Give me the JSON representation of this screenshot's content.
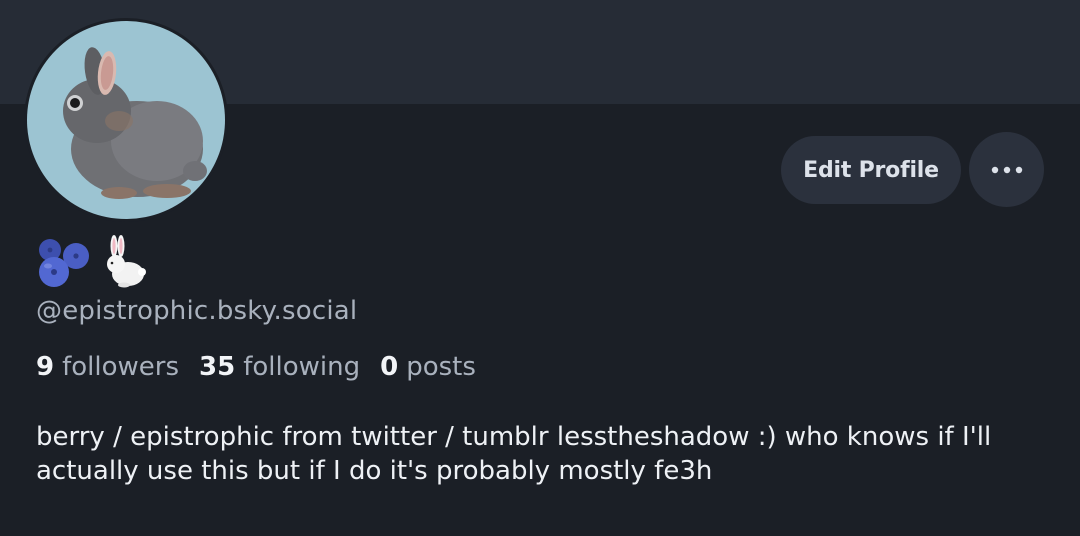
{
  "profile": {
    "display_name_icons": [
      "blueberries-icon",
      "rabbit-icon"
    ],
    "handle": "@epistrophic.bsky.social",
    "stats": {
      "followers_count": "9",
      "followers_label": "followers",
      "following_count": "35",
      "following_label": "following",
      "posts_count": "0",
      "posts_label": "posts"
    },
    "bio": "berry / epistrophic from twitter / tumblr lesstheshadow :) who knows if I'll actually use this but if I do it's probably mostly fe3h"
  },
  "actions": {
    "edit_profile_label": "Edit Profile",
    "more_icon": "ellipsis-icon"
  },
  "colors": {
    "background": "#1b1f26",
    "banner": "#262c36",
    "button": "#2b313d",
    "avatar_bg": "#9cc4d2",
    "muted_text": "#a9b1bd"
  }
}
